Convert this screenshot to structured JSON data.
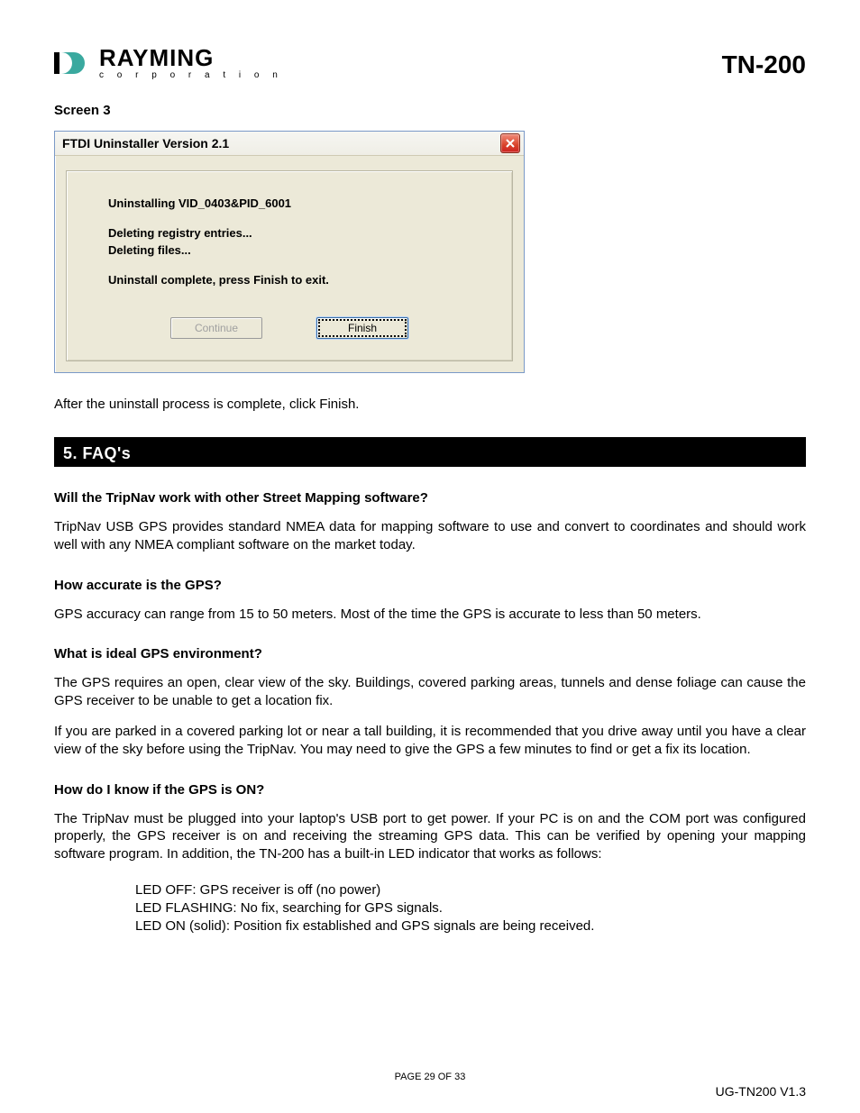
{
  "header": {
    "logo_name": "RAYMING",
    "logo_sub": "c o r p o r a t i o n",
    "model": "TN-200"
  },
  "screen_label": "Screen 3",
  "dialog": {
    "title": "FTDI Uninstaller Version 2.1",
    "line1": "Uninstalling VID_0403&PID_6001",
    "line2": "Deleting registry entries...",
    "line3": "Deleting files...",
    "line4": "Uninstall complete, press Finish to exit.",
    "continue_label": "Continue",
    "finish_label": "Finish"
  },
  "post_dialog_text": "After the uninstall process is complete, click Finish.",
  "section_heading": "5.  FAQ's",
  "faqs": [
    {
      "q": "Will the TripNav work with other Street Mapping software?",
      "a": "TripNav USB GPS provides standard NMEA data for mapping software to use and convert to coordinates and should work well with any NMEA compliant software on the market today."
    },
    {
      "q": "How accurate is the GPS?",
      "a": "GPS accuracy can range from 15 to 50 meters. Most of the time the GPS is accurate to less than 50 meters."
    },
    {
      "q": "What is ideal GPS environment?",
      "a": "The GPS requires an open, clear view of the sky. Buildings, covered parking areas, tunnels and dense foliage can cause the GPS receiver to be unable to get a location fix."
    }
  ],
  "faq3_extra": "If you are parked in a covered parking lot or near a tall building, it is recommended that you drive away until you have a clear view of the sky before using the TripNav.  You may need to give the GPS a few minutes to find or get a fix its location.",
  "faq4": {
    "q": "How do I know if the GPS is ON?",
    "a": "The TripNav must be plugged into your laptop's USB port to get power.  If your PC is on and the COM port was configured properly, the GPS receiver is on and receiving the streaming GPS data.  This can be verified by opening your mapping software program.  In addition, the TN-200 has a built-in LED indicator that works as follows:"
  },
  "led": {
    "off": "LED OFF: GPS receiver is off (no power)",
    "flashing": "LED FLASHING: No fix, searching for GPS signals.",
    "on": "LED ON (solid): Position fix established and GPS signals are being received."
  },
  "footer": {
    "page": "PAGE 29 OF 33",
    "doc": "UG-TN200 V1.3"
  }
}
